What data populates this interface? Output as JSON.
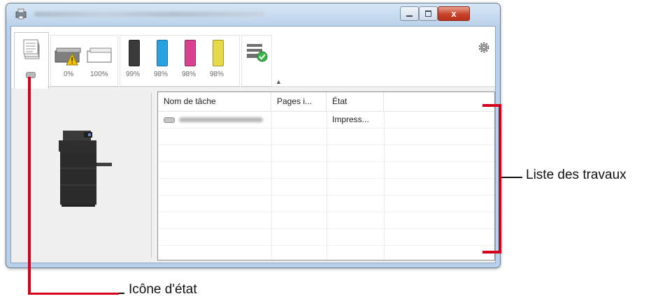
{
  "window": {
    "controls": {
      "close_label": "x"
    }
  },
  "toolbar": {
    "status_tab": {
      "icon": "document-stack-icon",
      "status_lamp": "status-lamp-icon"
    },
    "paper": [
      {
        "percent": "0%",
        "icon": "paper-tray-warning-icon"
      },
      {
        "percent": "100%",
        "icon": "paper-tray-icon"
      }
    ],
    "toner": [
      {
        "percent": "99%",
        "color": "#3a3a3a"
      },
      {
        "percent": "98%",
        "color": "#29a3e0"
      },
      {
        "percent": "98%",
        "color": "#d8428f"
      },
      {
        "percent": "98%",
        "color": "#e8d94a"
      }
    ],
    "settings_icon": "gear-icon",
    "collapse_icon": "collapse-arrow-icon",
    "scanner_icon": "scanner-check-icon"
  },
  "job_list": {
    "headers": [
      "Nom de tâche",
      "Pages i...",
      "État"
    ],
    "rows": [
      {
        "name": "",
        "pages": "",
        "status": "Impress..."
      }
    ]
  },
  "annotations": {
    "job_list_label": "Liste des travaux",
    "status_icon_label": "Icône d'état"
  },
  "colors": {
    "annotation": "#d6001c",
    "title_bar": "#bcd3ec"
  }
}
